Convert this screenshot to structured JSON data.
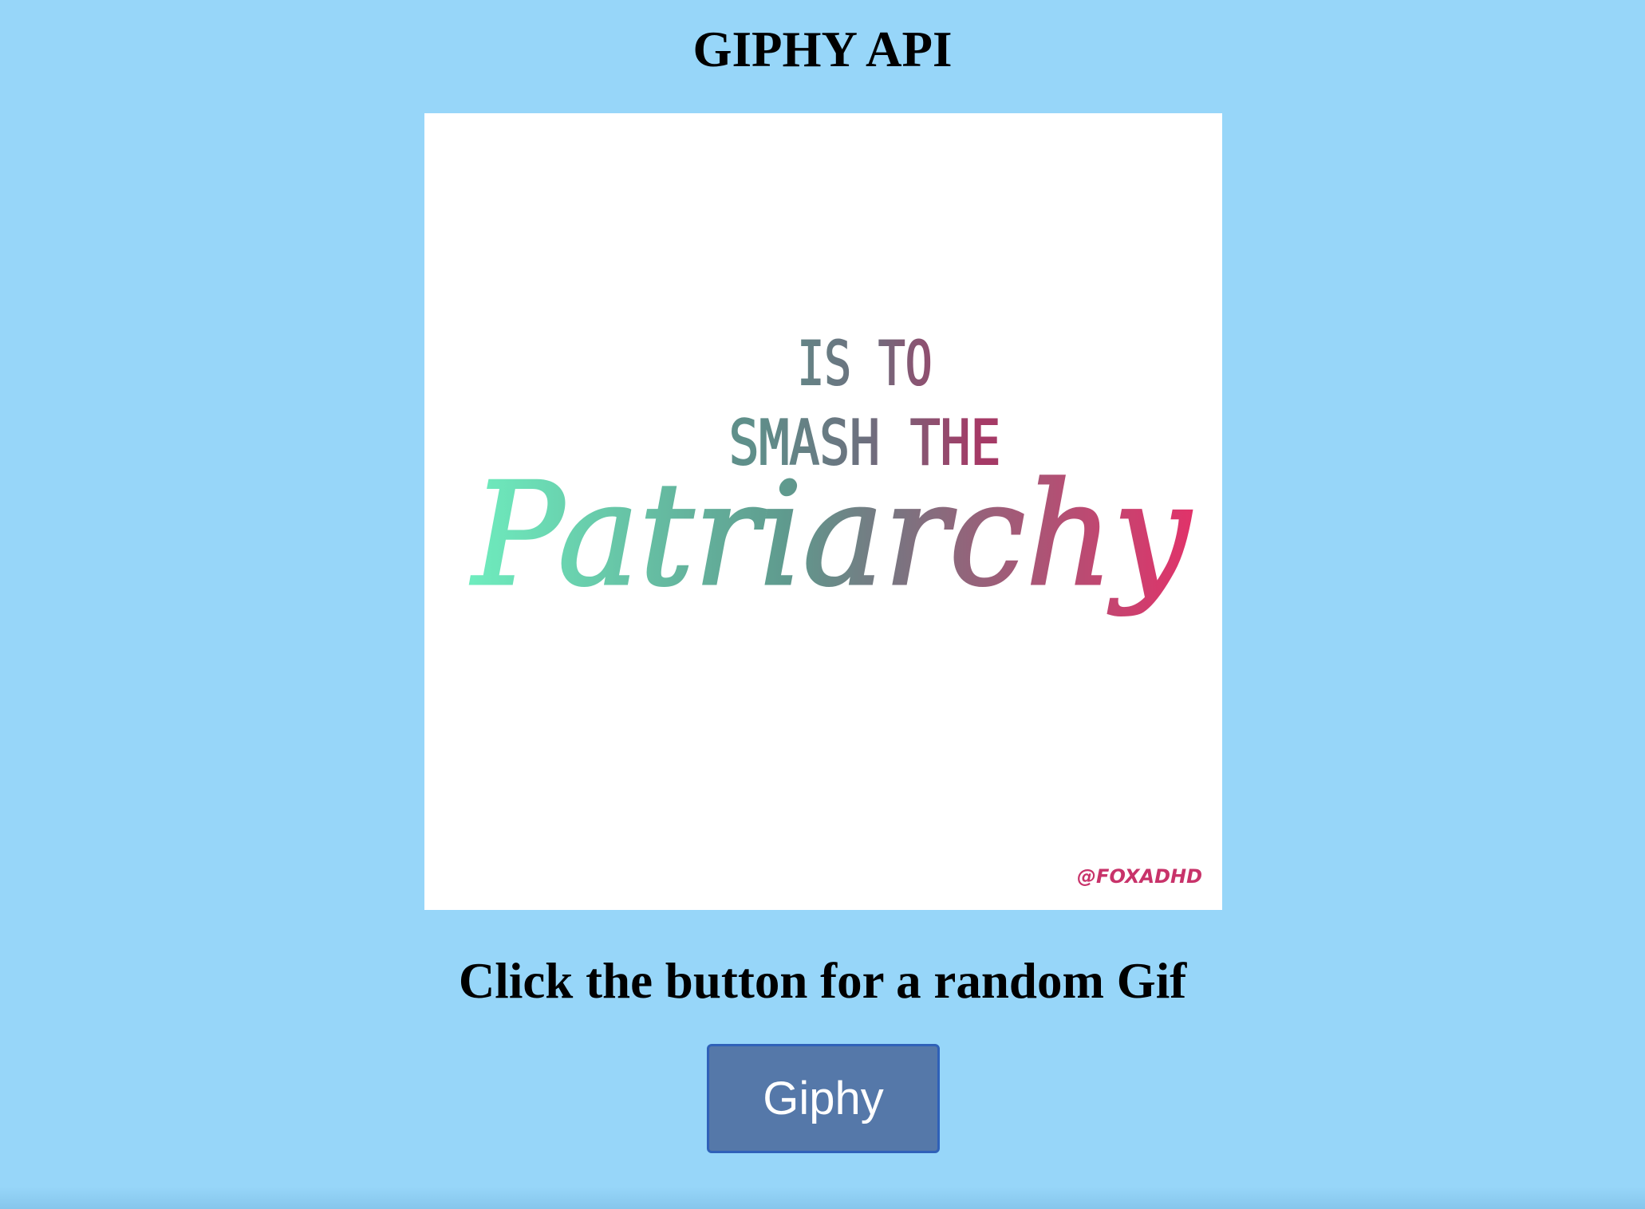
{
  "header": {
    "title": "GIPHY API"
  },
  "gif": {
    "line1": "IS TO",
    "line2": "SMASH THE",
    "script_word": "Patriarchy",
    "watermark": "@FOXADHD",
    "colors": {
      "gradient_start": "#6ff0c0",
      "gradient_mid": "#5f8a86",
      "gradient_end": "#e0336a",
      "caps_start": "#5f8f8a",
      "caps_end": "#a03a64"
    }
  },
  "main": {
    "instructions": "Click the button for a random Gif",
    "button_label": "Giphy"
  },
  "colors": {
    "background": "#97d6f9",
    "button_bg": "#5578a9",
    "button_border": "#2f61b8"
  }
}
